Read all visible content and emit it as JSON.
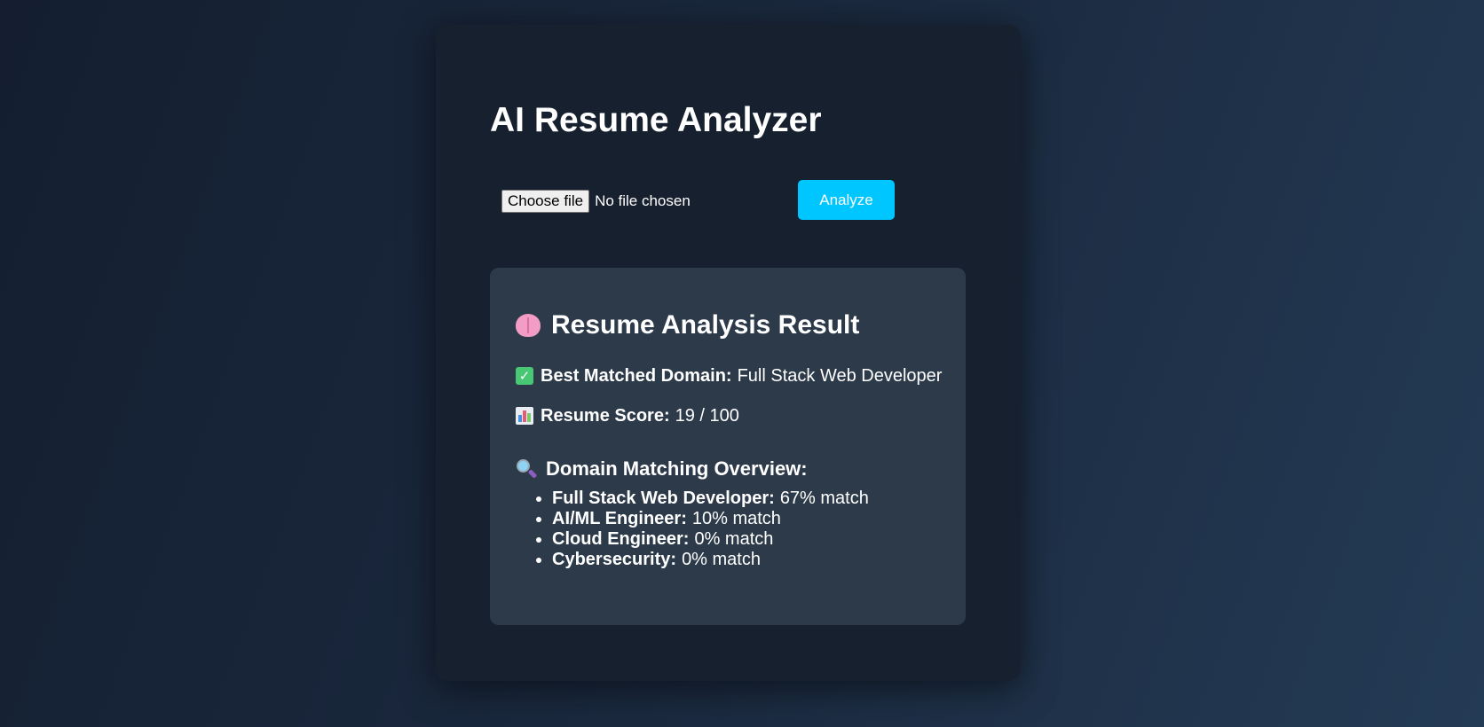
{
  "page": {
    "title": "AI Resume Analyzer"
  },
  "upload": {
    "choose_label": "Choose file",
    "status": "No file chosen",
    "analyze_label": "Analyze"
  },
  "result": {
    "heading": "Resume Analysis Result",
    "best_domain_label": "Best Matched Domain:",
    "best_domain_value": "Full Stack Web Developer",
    "score_label": "Resume Score:",
    "score_value": "19 / 100",
    "overview_heading": "Domain Matching Overview:",
    "domains": [
      {
        "name": "Full Stack Web Developer:",
        "match": "67% match"
      },
      {
        "name": "AI/ML Engineer:",
        "match": "10% match"
      },
      {
        "name": "Cloud Engineer:",
        "match": "0% match"
      },
      {
        "name": "Cybersecurity:",
        "match": "0% match"
      }
    ]
  },
  "icons": {
    "heading_icon": "brain-icon",
    "best_domain_icon": "check-mark-icon",
    "score_icon": "bar-chart-icon",
    "overview_icon": "magnifying-glass-icon"
  },
  "colors": {
    "accent": "#00c6ff",
    "card": "#17202f",
    "result_panel": "#2d3a4a",
    "check": "#48c774"
  }
}
